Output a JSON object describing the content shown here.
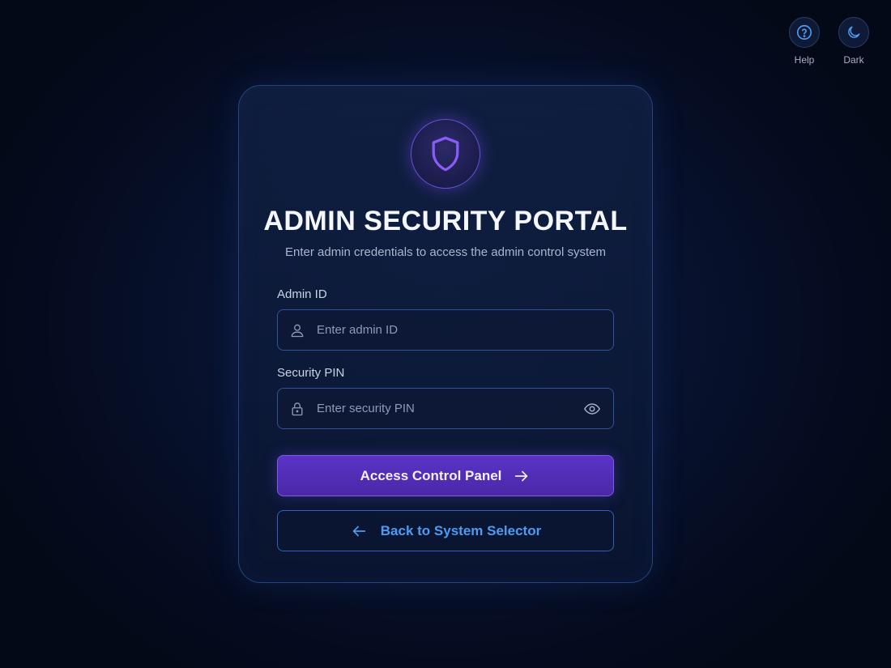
{
  "top_actions": {
    "help": {
      "label": "Help",
      "icon": "help-circle-icon"
    },
    "dark": {
      "label": "Dark",
      "icon": "moon-icon"
    }
  },
  "card": {
    "badge_icon": "shield-icon",
    "title": "ADMIN SECURITY PORTAL",
    "subtitle": "Enter admin credentials to access the admin control system",
    "admin_id": {
      "label": "Admin ID",
      "placeholder": "Enter admin ID",
      "value": "",
      "icon": "user-icon"
    },
    "security_pin": {
      "label": "Security PIN",
      "placeholder": "Enter security PIN",
      "value": "",
      "icon": "lock-icon",
      "toggle_icon": "eye-icon"
    },
    "primary_button": {
      "label": "Access Control Panel",
      "icon": "arrow-right-icon"
    },
    "secondary_button": {
      "label": "Back to System Selector",
      "icon": "arrow-left-icon"
    }
  },
  "colors": {
    "background": "#050b1f",
    "accent_purple": "#5a33c6",
    "accent_blue": "#4d9bf2",
    "border_blue": "#2e5599"
  }
}
